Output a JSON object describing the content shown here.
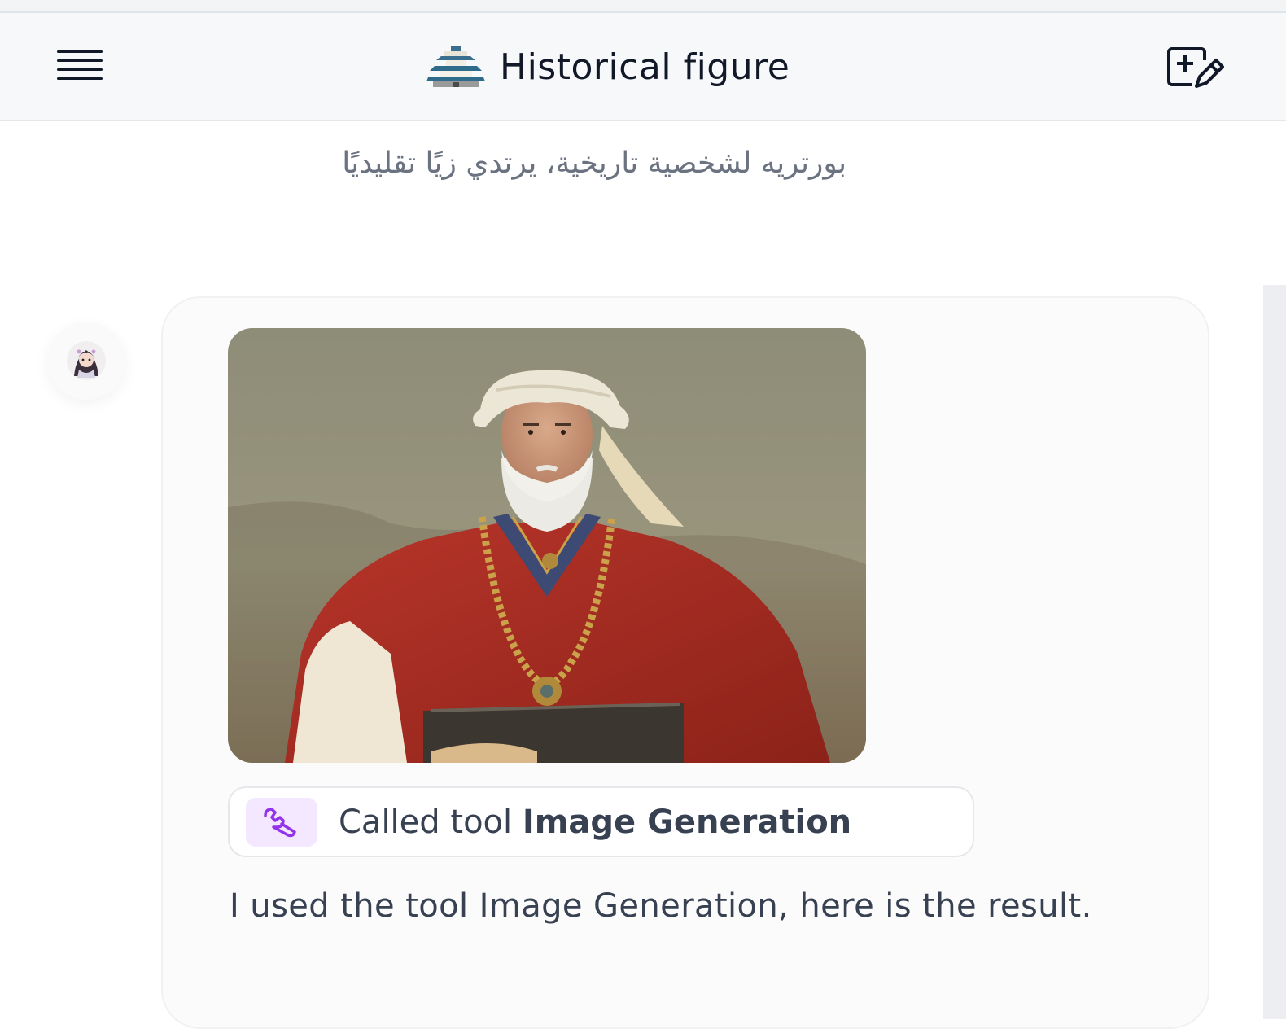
{
  "header": {
    "title": "Historical figure",
    "menu_icon": "hamburger-menu-icon",
    "app_icon": "pagoda-icon",
    "new_chat_icon": "new-chat-edit-icon"
  },
  "conversation": {
    "user_message": "بورتريه لشخصية تاريخية، يرتدي زيًا تقليديًا",
    "assistant": {
      "avatar_icon": "character-avatar",
      "image_alt": "Generated portrait: elderly bearded man in white turban and red traditional robe with gold chain",
      "tool_call": {
        "icon": "wrench-icon",
        "prefix": "Called tool",
        "tool_name": "Image Generation"
      },
      "response_text": "I used the tool Image Generation, here is the result."
    }
  },
  "colors": {
    "header_bg": "#f7f8fa",
    "tool_icon_bg": "#f3e8ff",
    "tool_icon_stroke": "#9333ea",
    "robe_red": "#a52a1e",
    "turban": "#ece6d6"
  }
}
